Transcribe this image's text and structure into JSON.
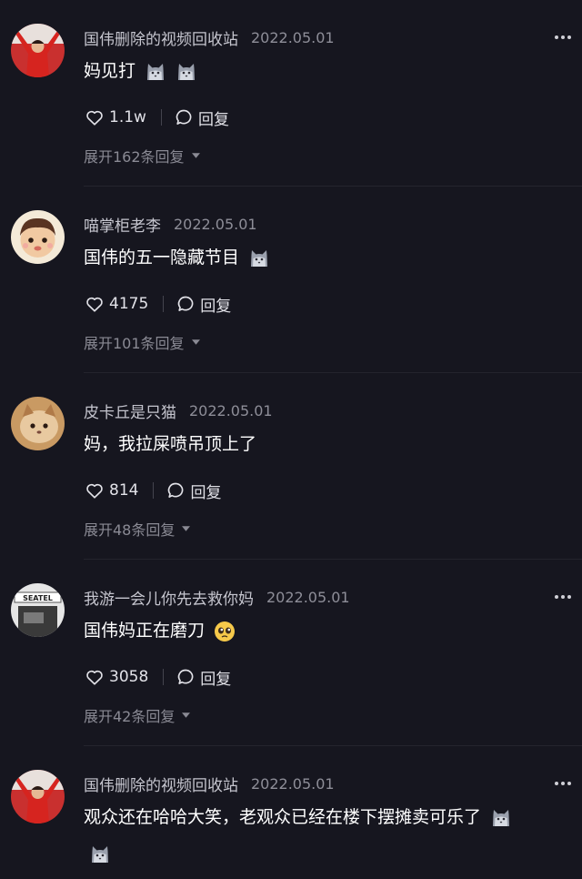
{
  "comments": [
    {
      "username": "国伟删除的视频回收站",
      "date": "2022.05.01",
      "text": "妈见打",
      "emojis": [
        "cat-emoji",
        "cat-emoji"
      ],
      "likes": "1.1w",
      "reply_label": "回复",
      "expand_label": "展开162条回复"
    },
    {
      "username": "喵掌柜老李",
      "date": "2022.05.01",
      "text": "国伟的五一隐藏节目",
      "emojis": [
        "cat-emoji"
      ],
      "likes": "4175",
      "reply_label": "回复",
      "expand_label": "展开101条回复"
    },
    {
      "username": "皮卡丘是只猫",
      "date": "2022.05.01",
      "text": "妈，我拉屎喷吊顶上了",
      "emojis": [],
      "likes": "814",
      "reply_label": "回复",
      "expand_label": "展开48条回复"
    },
    {
      "username": "我游一会儿你先去救你妈",
      "date": "2022.05.01",
      "text": "国伟妈正在磨刀",
      "emojis": [
        "pleading-face-emoji"
      ],
      "likes": "3058",
      "reply_label": "回复",
      "expand_label": "展开42条回复"
    },
    {
      "username": "国伟删除的视频回收站",
      "date": "2022.05.01",
      "text": "观众还在哈哈大笑，老观众已经在楼下摆摊卖可乐了",
      "emojis": [
        "cat-emoji",
        "cat-emoji"
      ],
      "likes": "",
      "reply_label": "",
      "expand_label": ""
    }
  ],
  "icons": {
    "like": "heart-outline-icon",
    "reply": "speech-bubble-icon",
    "more": "three-dots-icon",
    "expand": "caret-down-icon"
  },
  "colors": {
    "background": "#16161f",
    "username": "#c5c5ce",
    "date": "#8e8e98",
    "text": "#ffffff",
    "secondary": "#8a8a94"
  }
}
